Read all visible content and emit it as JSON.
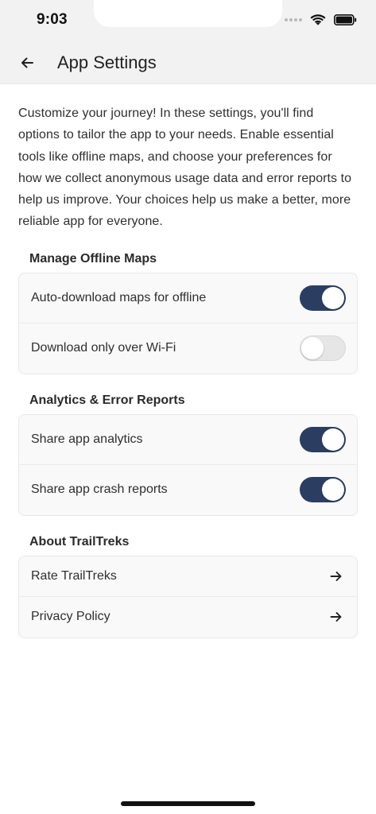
{
  "status_bar": {
    "time": "9:03"
  },
  "header": {
    "title": "App Settings"
  },
  "intro_text": "Customize your journey! In these settings, you'll find options to tailor the app to your needs. Enable essential tools like offline maps, and choose your preferences for how we collect anonymous usage data and error reports to help us improve. Your choices help us make a better, more reliable app for everyone.",
  "sections": {
    "offline_maps": {
      "title": "Manage Offline Maps",
      "items": [
        {
          "label": "Auto-download maps for offline",
          "enabled": true
        },
        {
          "label": "Download only over Wi-Fi",
          "enabled": false
        }
      ]
    },
    "analytics": {
      "title": "Analytics & Error Reports",
      "items": [
        {
          "label": "Share app analytics",
          "enabled": true
        },
        {
          "label": "Share app crash reports",
          "enabled": true
        }
      ]
    },
    "about": {
      "title": "About TrailTreks",
      "items": [
        {
          "label": "Rate TrailTreks",
          "icon": "arrow-right-icon"
        },
        {
          "label": "Privacy Policy",
          "icon": "arrow-right-icon"
        }
      ]
    }
  },
  "colors": {
    "toggle_on": "#2b3e62",
    "toggle_off": "#e6e6e6",
    "header_bg": "#f2f2f2",
    "card_bg": "#f9f9f9"
  }
}
